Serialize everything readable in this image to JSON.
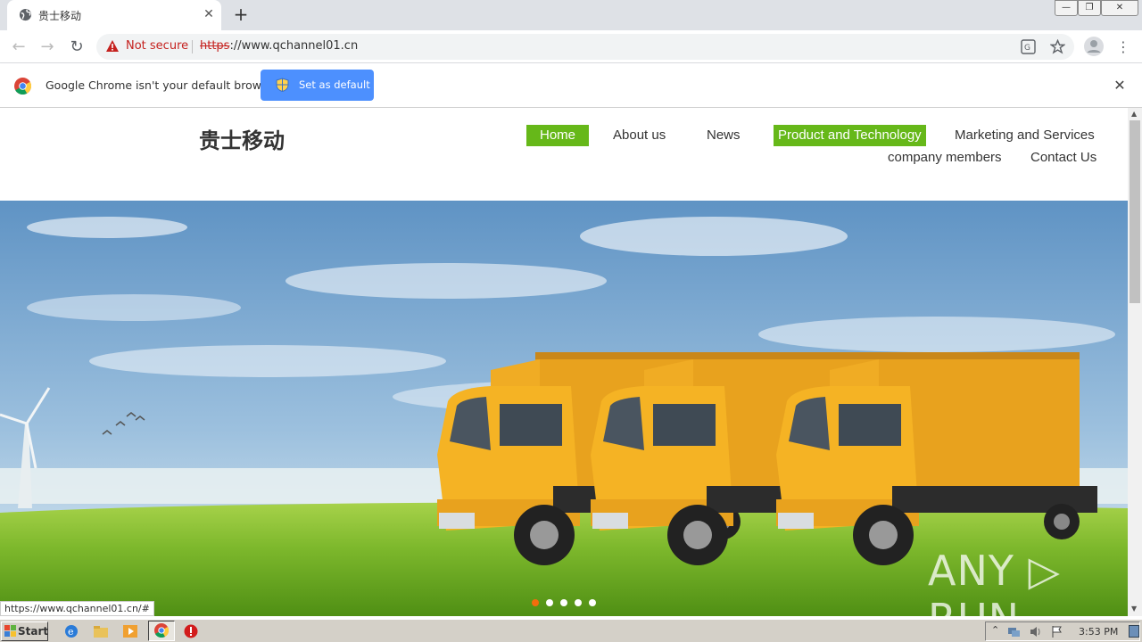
{
  "browser": {
    "tab_title": "贵士移动",
    "tab_close": "✕",
    "new_tab": "+",
    "security_label": "Not secure",
    "url_scheme": "https",
    "url_rest": "://www.qchannel01.cn",
    "window_controls": [
      "—",
      "❐",
      "✕"
    ]
  },
  "infobar": {
    "message": "Google Chrome isn't your default browser",
    "button": "Set as default",
    "close": "✕"
  },
  "site": {
    "logo": "贵士移动",
    "nav": [
      {
        "label": "Home",
        "active": true
      },
      {
        "label": "About us",
        "active": false
      },
      {
        "label": "News",
        "active": false
      },
      {
        "label": "Product and Technology",
        "active": true
      },
      {
        "label": "Marketing and Services",
        "active": false
      },
      {
        "label": "company members",
        "active": false
      },
      {
        "label": "Contact Us",
        "active": false
      }
    ],
    "slider": {
      "count": 5,
      "active_index": 0
    },
    "accent": "#66b819",
    "watermark": "ANY ▷ RUN"
  },
  "status_url": "https://www.qchannel01.cn/#",
  "taskbar": {
    "start": "Start",
    "clock": "3:53 PM"
  }
}
